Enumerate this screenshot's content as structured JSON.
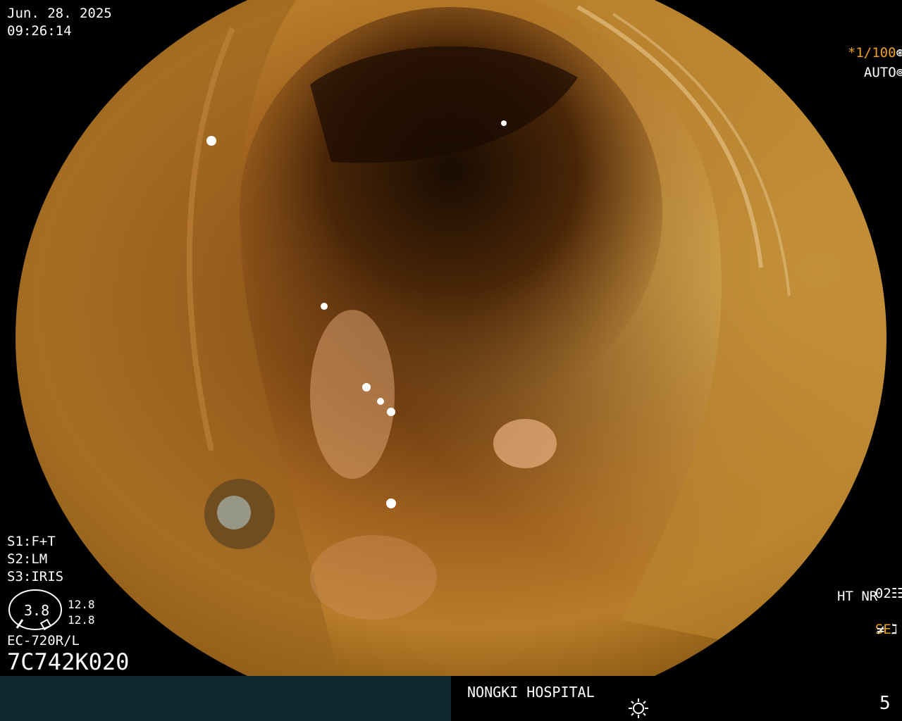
{
  "header": {
    "date": "Jun. 28. 2025",
    "time": "09:26:14"
  },
  "top_right": {
    "shutter": "*1/100",
    "mode": "AUTO",
    "shutter_icon": "aperture-icon",
    "auto_icon": "iris-icon"
  },
  "left_settings": [
    "S1:F+T",
    "S2:LM",
    "S3:IRIS"
  ],
  "gauge": {
    "center_value": "3.8",
    "value_top": "12.8",
    "value_bottom": "12.8"
  },
  "scope": {
    "model": "EC-720R/L",
    "serial": "7C742K020"
  },
  "right_settings": {
    "preset": "02",
    "mode_line": "HT NR",
    "se": "SE",
    "se_icon": "wave-icon",
    "filter_icon": "not-equal-icon"
  },
  "footer": {
    "hospital": "NONGKI HOSPITAL",
    "page": "5",
    "light_icon": "sun-icon"
  },
  "colors": {
    "accent": "#f0a020",
    "footer_bg": "#0f2a2e"
  }
}
